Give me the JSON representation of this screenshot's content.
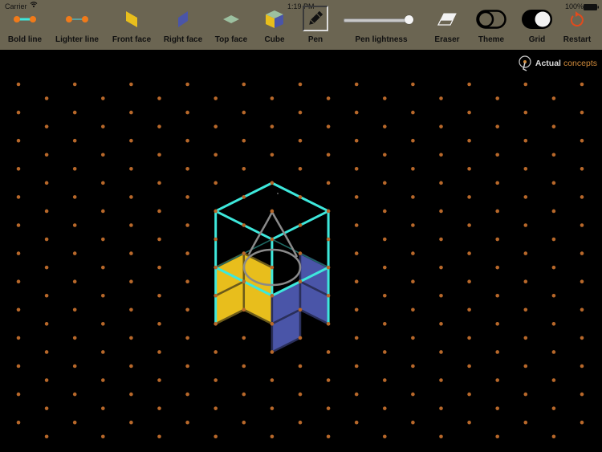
{
  "status_bar": {
    "carrier": "Carrier",
    "time": "1:19 PM",
    "battery": "100%"
  },
  "toolbar": {
    "tools": [
      {
        "id": "bold-line",
        "label": "Bold line",
        "icon": "bold-line-icon"
      },
      {
        "id": "lighter-line",
        "label": "Lighter line",
        "icon": "lighter-line-icon"
      },
      {
        "id": "front-face",
        "label": "Front face",
        "icon": "front-face-icon"
      },
      {
        "id": "right-face",
        "label": "Right face",
        "icon": "right-face-icon"
      },
      {
        "id": "top-face",
        "label": "Top face",
        "icon": "top-face-icon"
      },
      {
        "id": "cube",
        "label": "Cube",
        "icon": "cube-icon"
      },
      {
        "id": "pen",
        "label": "Pen",
        "icon": "pen-icon",
        "selected": true
      },
      {
        "id": "pen-lightness",
        "label": "Pen lightness",
        "icon": "slider"
      },
      {
        "id": "eraser",
        "label": "Eraser",
        "icon": "eraser-icon"
      },
      {
        "id": "theme",
        "label": "Theme",
        "icon": "theme-toggle-icon"
      },
      {
        "id": "grid",
        "label": "Grid",
        "icon": "grid-toggle-icon"
      },
      {
        "id": "restart",
        "label": "Restart",
        "icon": "restart-icon"
      }
    ],
    "pen_lightness": 0.95,
    "theme_on": false,
    "grid_on": true
  },
  "logo": {
    "word1": "Actual",
    "word2": "concepts"
  },
  "colors": {
    "toolbar_bg": "#6b6552",
    "canvas_bg": "#000000",
    "grid_dot": "#b8682a",
    "bold_line": "#3ee8dc",
    "front_face": "#e8be1c",
    "right_face": "#4a55a8",
    "top_face": "#9cc0a0",
    "pen_stroke": "#8a8a8a",
    "restart": "#e24a1c"
  },
  "drawing": {
    "grid": {
      "columns": 21,
      "rows_per_column": 13
    },
    "bold_lines": [
      [
        [
          9,
          3
        ],
        [
          11,
          4
        ]
      ],
      [
        [
          11,
          4
        ],
        [
          11,
          6
        ]
      ],
      [
        [
          11,
          6
        ],
        [
          9,
          7
        ]
      ],
      [
        [
          9,
          7
        ],
        [
          7,
          6
        ]
      ],
      [
        [
          7,
          6
        ],
        [
          7,
          4
        ]
      ],
      [
        [
          7,
          4
        ],
        [
          9,
          3
        ]
      ],
      [
        [
          9,
          5
        ],
        [
          11,
          4
        ]
      ],
      [
        [
          9,
          5
        ],
        [
          7,
          4
        ]
      ],
      [
        [
          9,
          5
        ],
        [
          9,
          7
        ]
      ],
      [
        [
          7,
          6
        ],
        [
          7,
          8
        ]
      ],
      [
        [
          11,
          6
        ],
        [
          11,
          8
        ]
      ]
    ],
    "lighter_lines": [
      [
        [
          7,
          6
        ],
        [
          9,
          5
        ]
      ],
      [
        [
          9,
          5
        ],
        [
          11,
          6
        ]
      ]
    ],
    "front_faces": [
      {
        "col": 7,
        "row": 6
      },
      {
        "col": 8,
        "row": 6
      },
      {
        "col": 7,
        "row": 7
      },
      {
        "col": 8,
        "row": 7
      }
    ],
    "right_faces": [
      {
        "col": 9,
        "row": 7
      },
      {
        "col": 10,
        "row": 6
      },
      {
        "col": 9,
        "row": 8
      },
      {
        "col": 10,
        "row": 7
      }
    ]
  }
}
